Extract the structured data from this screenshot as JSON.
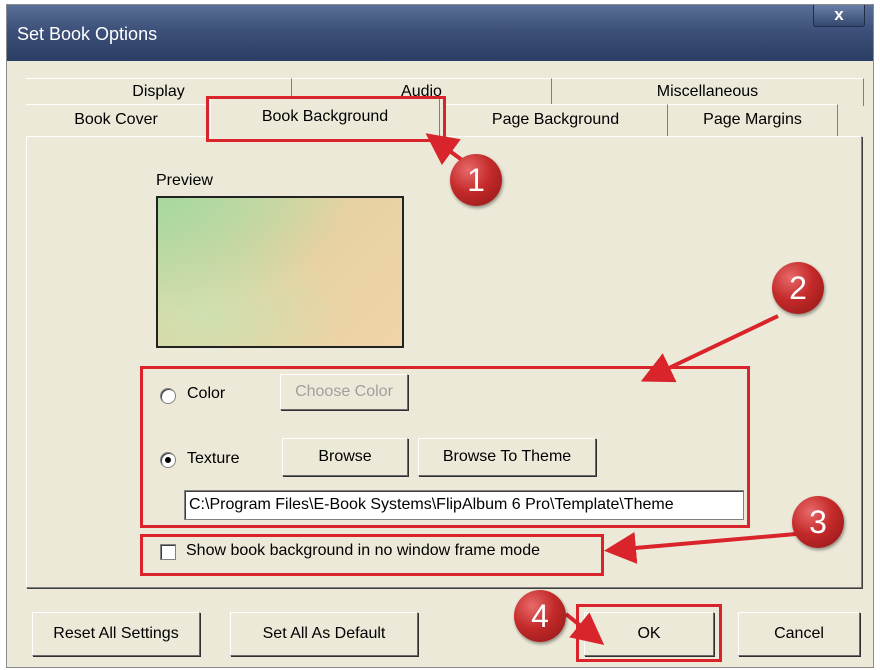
{
  "window": {
    "title": "Set Book Options",
    "close_label": "x"
  },
  "tabs": {
    "row1": [
      "Display",
      "Audio",
      "Miscellaneous"
    ],
    "row2": [
      "Book Cover",
      "Book Background",
      "Page Background",
      "Page Margins"
    ],
    "active": "Book Background"
  },
  "panel": {
    "preview_label": "Preview",
    "color_radio_label": "Color",
    "choose_color_label": "Choose Color",
    "texture_radio_label": "Texture",
    "browse_label": "Browse",
    "browse_theme_label": "Browse To Theme",
    "texture_path": "C:\\Program Files\\E-Book Systems\\FlipAlbum 6 Pro\\Template\\Theme",
    "checkbox_label": "Show book background in no window frame mode",
    "color_selected": false,
    "texture_selected": true,
    "checkbox_checked": false
  },
  "footer": {
    "reset_label": "Reset All Settings",
    "default_label": "Set All As Default",
    "ok_label": "OK",
    "cancel_label": "Cancel"
  },
  "annotations": {
    "markers": [
      "1",
      "2",
      "3",
      "4"
    ],
    "color": "#d8242a"
  }
}
